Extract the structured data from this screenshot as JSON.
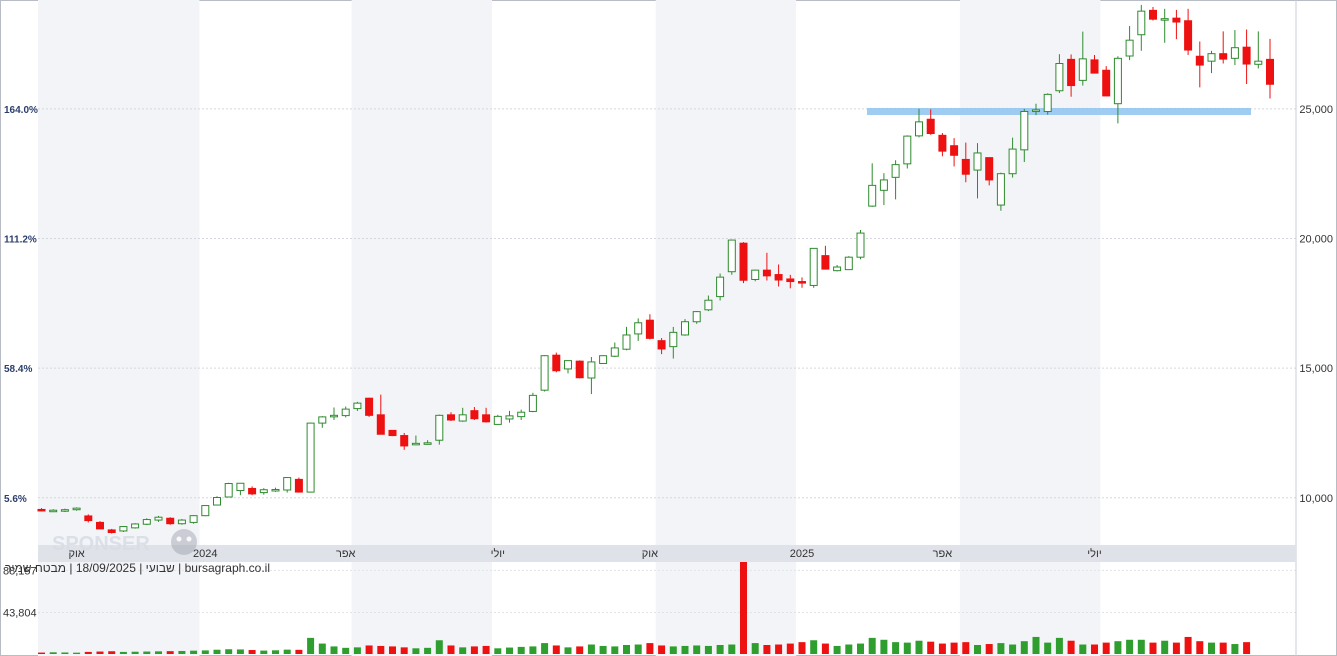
{
  "caption": "שבועי | 18/09/2025 | מבטח שמיר | bursagraph.co.il",
  "watermark": "SPONSER",
  "chart_data": {
    "type": "candlestick",
    "price_axis": {
      "ylim": [
        7600,
        29200
      ],
      "ticks": [
        10000,
        15000,
        20000,
        25000
      ],
      "tick_labels": [
        "10,000",
        "15,000",
        "20,000",
        "25,000"
      ]
    },
    "percent_axis": {
      "tick_labels": [
        "5.6%",
        "58.4%",
        "111.2%",
        "164.0%"
      ],
      "tick_prices": [
        10000,
        15000,
        20000,
        25000
      ]
    },
    "time_axis": {
      "labels": [
        "אוק",
        "2024",
        "אפר",
        "יולי",
        "אוק",
        "2025",
        "אפר",
        "יולי"
      ],
      "label_index": [
        3,
        14,
        26,
        39,
        52,
        65,
        77,
        90
      ]
    },
    "shaded_ranges": [
      [
        0,
        14
      ],
      [
        27,
        39
      ],
      [
        53,
        65
      ],
      [
        79,
        91
      ]
    ],
    "support_level": 24900,
    "volume_axis": {
      "ylim": [
        0,
        97000
      ],
      "tick_labels": [
        "88,157",
        "43,804"
      ],
      "ticks": [
        88157,
        43804
      ]
    },
    "candles": [
      {
        "o": 9550,
        "h": 9600,
        "l": 9480,
        "c": 9500
      },
      {
        "o": 9480,
        "h": 9560,
        "l": 9450,
        "c": 9520
      },
      {
        "o": 9490,
        "h": 9580,
        "l": 9450,
        "c": 9540
      },
      {
        "o": 9540,
        "h": 9630,
        "l": 9500,
        "c": 9600
      },
      {
        "o": 9300,
        "h": 9360,
        "l": 9050,
        "c": 9120
      },
      {
        "o": 9050,
        "h": 9100,
        "l": 8780,
        "c": 8800
      },
      {
        "o": 8760,
        "h": 8800,
        "l": 8620,
        "c": 8660
      },
      {
        "o": 8720,
        "h": 8910,
        "l": 8680,
        "c": 8890
      },
      {
        "o": 8840,
        "h": 9020,
        "l": 8810,
        "c": 8990
      },
      {
        "o": 8980,
        "h": 9210,
        "l": 8950,
        "c": 9160
      },
      {
        "o": 9140,
        "h": 9300,
        "l": 9070,
        "c": 9250
      },
      {
        "o": 9210,
        "h": 9250,
        "l": 8960,
        "c": 9000
      },
      {
        "o": 9000,
        "h": 9180,
        "l": 8960,
        "c": 9140
      },
      {
        "o": 9050,
        "h": 9330,
        "l": 9000,
        "c": 9310
      },
      {
        "o": 9310,
        "h": 9720,
        "l": 9290,
        "c": 9700
      },
      {
        "o": 9720,
        "h": 10060,
        "l": 9700,
        "c": 10010
      },
      {
        "o": 10030,
        "h": 10580,
        "l": 10010,
        "c": 10550
      },
      {
        "o": 10280,
        "h": 10570,
        "l": 10100,
        "c": 10560
      },
      {
        "o": 10360,
        "h": 10440,
        "l": 10100,
        "c": 10150
      },
      {
        "o": 10200,
        "h": 10370,
        "l": 10120,
        "c": 10310
      },
      {
        "o": 10300,
        "h": 10390,
        "l": 10230,
        "c": 10320
      },
      {
        "o": 10300,
        "h": 10800,
        "l": 10200,
        "c": 10780
      },
      {
        "o": 10710,
        "h": 10780,
        "l": 10200,
        "c": 10220
      },
      {
        "o": 10220,
        "h": 12900,
        "l": 10200,
        "c": 12880
      },
      {
        "o": 12880,
        "h": 13150,
        "l": 12700,
        "c": 13120
      },
      {
        "o": 13140,
        "h": 13480,
        "l": 13000,
        "c": 13180
      },
      {
        "o": 13170,
        "h": 13520,
        "l": 13100,
        "c": 13420
      },
      {
        "o": 13440,
        "h": 13700,
        "l": 13350,
        "c": 13650
      },
      {
        "o": 13840,
        "h": 13860,
        "l": 13120,
        "c": 13180
      },
      {
        "o": 13200,
        "h": 13980,
        "l": 12450,
        "c": 12450
      },
      {
        "o": 12600,
        "h": 12600,
        "l": 12380,
        "c": 12400
      },
      {
        "o": 12400,
        "h": 12500,
        "l": 11850,
        "c": 12000
      },
      {
        "o": 12100,
        "h": 12400,
        "l": 12050,
        "c": 12100
      },
      {
        "o": 12100,
        "h": 12220,
        "l": 12050,
        "c": 12120
      },
      {
        "o": 12220,
        "h": 13210,
        "l": 12050,
        "c": 13180
      },
      {
        "o": 13200,
        "h": 13300,
        "l": 12960,
        "c": 13000
      },
      {
        "o": 12960,
        "h": 13470,
        "l": 12930,
        "c": 13200
      },
      {
        "o": 13360,
        "h": 13500,
        "l": 13000,
        "c": 13050
      },
      {
        "o": 13200,
        "h": 13470,
        "l": 12900,
        "c": 12930
      },
      {
        "o": 12830,
        "h": 13200,
        "l": 12820,
        "c": 13140
      },
      {
        "o": 13040,
        "h": 13350,
        "l": 12900,
        "c": 13160
      },
      {
        "o": 13130,
        "h": 13400,
        "l": 13000,
        "c": 13300
      },
      {
        "o": 13330,
        "h": 14050,
        "l": 13300,
        "c": 13950
      },
      {
        "o": 14150,
        "h": 15500,
        "l": 14100,
        "c": 15480
      },
      {
        "o": 15500,
        "h": 15600,
        "l": 14840,
        "c": 14900
      },
      {
        "o": 14970,
        "h": 15300,
        "l": 14800,
        "c": 15290
      },
      {
        "o": 15270,
        "h": 15300,
        "l": 14600,
        "c": 14630
      },
      {
        "o": 14620,
        "h": 15430,
        "l": 14000,
        "c": 15240
      },
      {
        "o": 15180,
        "h": 15500,
        "l": 15160,
        "c": 15480
      },
      {
        "o": 15460,
        "h": 15990,
        "l": 15430,
        "c": 15780
      },
      {
        "o": 15730,
        "h": 16590,
        "l": 15690,
        "c": 16280
      },
      {
        "o": 16320,
        "h": 16920,
        "l": 16050,
        "c": 16750
      },
      {
        "o": 16850,
        "h": 17080,
        "l": 16110,
        "c": 16150
      },
      {
        "o": 16060,
        "h": 16160,
        "l": 15540,
        "c": 15740
      },
      {
        "o": 15830,
        "h": 16590,
        "l": 15370,
        "c": 16380
      },
      {
        "o": 16280,
        "h": 16890,
        "l": 16250,
        "c": 16790
      },
      {
        "o": 16790,
        "h": 17200,
        "l": 16710,
        "c": 17180
      },
      {
        "o": 17250,
        "h": 17800,
        "l": 17200,
        "c": 17620
      },
      {
        "o": 17760,
        "h": 18650,
        "l": 17610,
        "c": 18510
      },
      {
        "o": 18720,
        "h": 19960,
        "l": 18600,
        "c": 19940
      },
      {
        "o": 19820,
        "h": 19860,
        "l": 18280,
        "c": 18390
      },
      {
        "o": 18420,
        "h": 18800,
        "l": 18350,
        "c": 18780
      },
      {
        "o": 18780,
        "h": 19450,
        "l": 18380,
        "c": 18560
      },
      {
        "o": 18610,
        "h": 19000,
        "l": 18150,
        "c": 18400
      },
      {
        "o": 18440,
        "h": 18600,
        "l": 18080,
        "c": 18340
      },
      {
        "o": 18340,
        "h": 18500,
        "l": 18100,
        "c": 18290
      },
      {
        "o": 18190,
        "h": 19620,
        "l": 18100,
        "c": 19620
      },
      {
        "o": 19340,
        "h": 19720,
        "l": 18800,
        "c": 18820
      },
      {
        "o": 18760,
        "h": 18980,
        "l": 18730,
        "c": 18900
      },
      {
        "o": 18800,
        "h": 19320,
        "l": 18800,
        "c": 19280
      },
      {
        "o": 19280,
        "h": 20330,
        "l": 19200,
        "c": 20210
      },
      {
        "o": 21250,
        "h": 22900,
        "l": 21220,
        "c": 22050
      },
      {
        "o": 21860,
        "h": 22520,
        "l": 21290,
        "c": 22260
      },
      {
        "o": 22360,
        "h": 23020,
        "l": 21510,
        "c": 22850
      },
      {
        "o": 22880,
        "h": 23980,
        "l": 22700,
        "c": 23950
      },
      {
        "o": 23960,
        "h": 25000,
        "l": 23900,
        "c": 24500
      },
      {
        "o": 24600,
        "h": 24980,
        "l": 24000,
        "c": 24050
      },
      {
        "o": 23980,
        "h": 24070,
        "l": 23170,
        "c": 23370
      },
      {
        "o": 23580,
        "h": 23870,
        "l": 22780,
        "c": 23210
      },
      {
        "o": 23050,
        "h": 23700,
        "l": 22170,
        "c": 22480
      },
      {
        "o": 22640,
        "h": 23680,
        "l": 21550,
        "c": 23300
      },
      {
        "o": 23120,
        "h": 23120,
        "l": 22050,
        "c": 22260
      },
      {
        "o": 21290,
        "h": 22540,
        "l": 21070,
        "c": 22500
      },
      {
        "o": 22500,
        "h": 23890,
        "l": 22350,
        "c": 23450
      },
      {
        "o": 23420,
        "h": 25000,
        "l": 22950,
        "c": 24900
      },
      {
        "o": 24940,
        "h": 25200,
        "l": 24760,
        "c": 24960
      },
      {
        "o": 24900,
        "h": 25600,
        "l": 24780,
        "c": 25560
      },
      {
        "o": 25700,
        "h": 27110,
        "l": 25610,
        "c": 26750
      },
      {
        "o": 26910,
        "h": 27100,
        "l": 25470,
        "c": 25900
      },
      {
        "o": 26100,
        "h": 27980,
        "l": 25900,
        "c": 26930
      },
      {
        "o": 26890,
        "h": 27080,
        "l": 26480,
        "c": 26380
      },
      {
        "o": 26490,
        "h": 26650,
        "l": 25500,
        "c": 25500
      },
      {
        "o": 25200,
        "h": 27030,
        "l": 24440,
        "c": 26950
      },
      {
        "o": 27040,
        "h": 28200,
        "l": 26880,
        "c": 27650
      },
      {
        "o": 27860,
        "h": 29010,
        "l": 27240,
        "c": 28770
      },
      {
        "o": 28800,
        "h": 28930,
        "l": 28410,
        "c": 28460
      },
      {
        "o": 28480,
        "h": 28860,
        "l": 27550,
        "c": 28480
      },
      {
        "o": 28500,
        "h": 28820,
        "l": 27690,
        "c": 28350
      },
      {
        "o": 28400,
        "h": 28860,
        "l": 27080,
        "c": 27270
      },
      {
        "o": 27030,
        "h": 27600,
        "l": 25830,
        "c": 26690
      },
      {
        "o": 26840,
        "h": 27240,
        "l": 26380,
        "c": 27130
      },
      {
        "o": 27130,
        "h": 27990,
        "l": 26750,
        "c": 26920
      },
      {
        "o": 26950,
        "h": 28040,
        "l": 26690,
        "c": 27360
      },
      {
        "o": 27380,
        "h": 28060,
        "l": 25960,
        "c": 26730
      },
      {
        "o": 26720,
        "h": 27990,
        "l": 26560,
        "c": 26840
      },
      {
        "o": 26910,
        "h": 27700,
        "l": 25400,
        "c": 25950
      }
    ],
    "volumes": [
      1500,
      1800,
      1600,
      1400,
      2200,
      2600,
      2900,
      2200,
      2400,
      2600,
      2800,
      3000,
      3200,
      3500,
      3800,
      4500,
      5000,
      4800,
      4200,
      3600,
      3900,
      4600,
      4400,
      17000,
      11000,
      8000,
      6500,
      7000,
      9000,
      8500,
      8000,
      7000,
      6000,
      6500,
      14500,
      9000,
      7000,
      8000,
      8500,
      6000,
      6800,
      7500,
      8000,
      11500,
      9000,
      7000,
      8000,
      10000,
      8500,
      8000,
      9500,
      10000,
      11500,
      9000,
      8000,
      8500,
      9000,
      8500,
      9500,
      10000,
      97000,
      11500,
      9500,
      10000,
      11000,
      12500,
      14500,
      11000,
      8500,
      10000,
      11000,
      17000,
      15000,
      12500,
      12000,
      14000,
      13000,
      11000,
      12000,
      12500,
      9500,
      10500,
      11500,
      10000,
      13500,
      18000,
      12000,
      17000,
      14000,
      10000,
      10000,
      12000,
      13500,
      15000,
      15000,
      12000,
      14000,
      12000,
      18000,
      13500,
      12000,
      12000,
      10500,
      12500
    ]
  }
}
